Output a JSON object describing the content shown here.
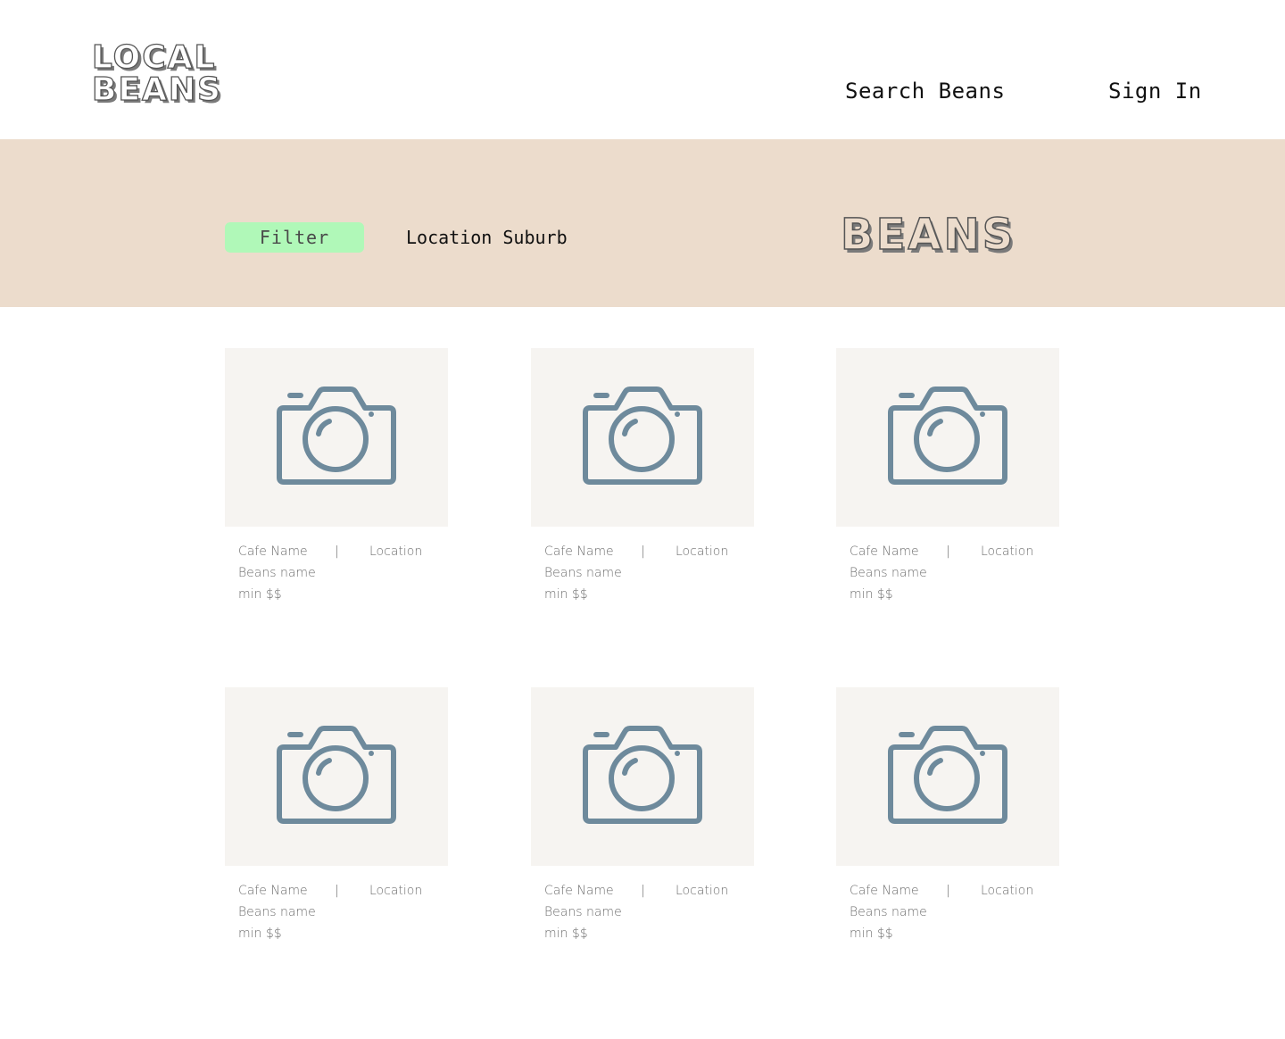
{
  "header": {
    "logo_line1": "LOCAL",
    "logo_line2": "BEANS",
    "nav": {
      "search_label": "Search Beans",
      "signin_label": "Sign In"
    }
  },
  "hero": {
    "filter_label": "Filter",
    "location_label": "Location Suburb",
    "title": "BEANS",
    "background_color": "#ecdccc",
    "filter_color": "#b0f8b8"
  },
  "cards": [
    {
      "cafe_name": "Cafe Name",
      "separator": "|",
      "location": "Location",
      "beans_name": "Beans name",
      "price": "min $$",
      "image_icon": "camera-icon"
    },
    {
      "cafe_name": "Cafe Name",
      "separator": "|",
      "location": "Location",
      "beans_name": "Beans name",
      "price": "min $$",
      "image_icon": "camera-icon"
    },
    {
      "cafe_name": "Cafe Name",
      "separator": "|",
      "location": "Location",
      "beans_name": "Beans name",
      "price": "min $$",
      "image_icon": "camera-icon"
    },
    {
      "cafe_name": "Cafe Name",
      "separator": "|",
      "location": "Location",
      "beans_name": "Beans name",
      "price": "min $$",
      "image_icon": "camera-icon"
    },
    {
      "cafe_name": "Cafe Name",
      "separator": "|",
      "location": "Location",
      "beans_name": "Beans name",
      "price": "min $$",
      "image_icon": "camera-icon"
    },
    {
      "cafe_name": "Cafe Name",
      "separator": "|",
      "location": "Location",
      "beans_name": "Beans name",
      "price": "min $$",
      "image_icon": "camera-icon"
    }
  ],
  "colors": {
    "icon": "#6e8a9c",
    "card_bg": "#f6f4f1",
    "text_muted": "#6e6e6e"
  }
}
